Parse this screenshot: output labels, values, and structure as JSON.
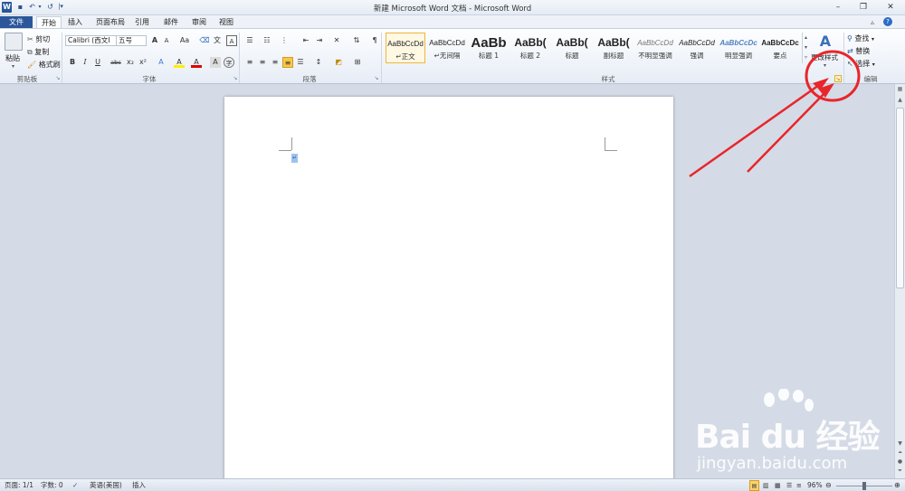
{
  "window": {
    "title": "新建 Microsoft Word 文档 - Microsoft Word",
    "logo_letter": "W"
  },
  "tabs": [
    "文件",
    "开始",
    "插入",
    "页面布局",
    "引用",
    "邮件",
    "审阅",
    "视图"
  ],
  "clipboard": {
    "paste": "粘贴",
    "cut": "剪切",
    "copy": "复制",
    "format_painter": "格式刷",
    "label": "剪贴板"
  },
  "font": {
    "name": "Calibri (西文Ⅰ",
    "size": "五号",
    "label": "字体",
    "bold": "B",
    "italic": "I",
    "underline": "U",
    "strike": "abc",
    "subscript": "x₂",
    "superscript": "x²",
    "grow": "A",
    "shrink": "A",
    "case": "Aa",
    "font_color": "A",
    "highlight": "A",
    "char_border": "A"
  },
  "paragraph": {
    "label": "段落"
  },
  "styles": {
    "label": "样式",
    "items": [
      {
        "sample": "AaBbCcDd",
        "name": "正文",
        "selected": true
      },
      {
        "sample": "AaBbCcDd",
        "name": "无间隔",
        "selected": false
      },
      {
        "sample": "AaBb",
        "name": "标题 1",
        "selected": false
      },
      {
        "sample": "AaBb(",
        "name": "标题 2",
        "selected": false
      },
      {
        "sample": "AaBb(",
        "name": "标题",
        "selected": false
      },
      {
        "sample": "AaBb(",
        "name": "副标题",
        "selected": false
      },
      {
        "sample": "AaBbCcDd",
        "name": "不明显强调",
        "selected": false
      },
      {
        "sample": "AaBbCcDd",
        "name": "强调",
        "selected": false
      },
      {
        "sample": "AaBbCcDc",
        "name": "明显强调",
        "selected": false
      },
      {
        "sample": "AaBbCcDc",
        "name": "要点",
        "selected": false
      }
    ],
    "change_styles": "更改样式"
  },
  "editing": {
    "find": "查找",
    "replace": "替换",
    "select": "选择",
    "label": "编辑"
  },
  "status": {
    "page": "页面: 1/1",
    "words": "字数: 0",
    "language": "英语(美国)",
    "mode": "插入",
    "zoom": "96%"
  },
  "watermark": {
    "brand": "Bai du 经验",
    "url": "jingyan.baidu.com"
  },
  "colors": {
    "file_tab": "#2b579a",
    "annotation": "#e8262b",
    "selected_style_border": "#f0b53a"
  }
}
